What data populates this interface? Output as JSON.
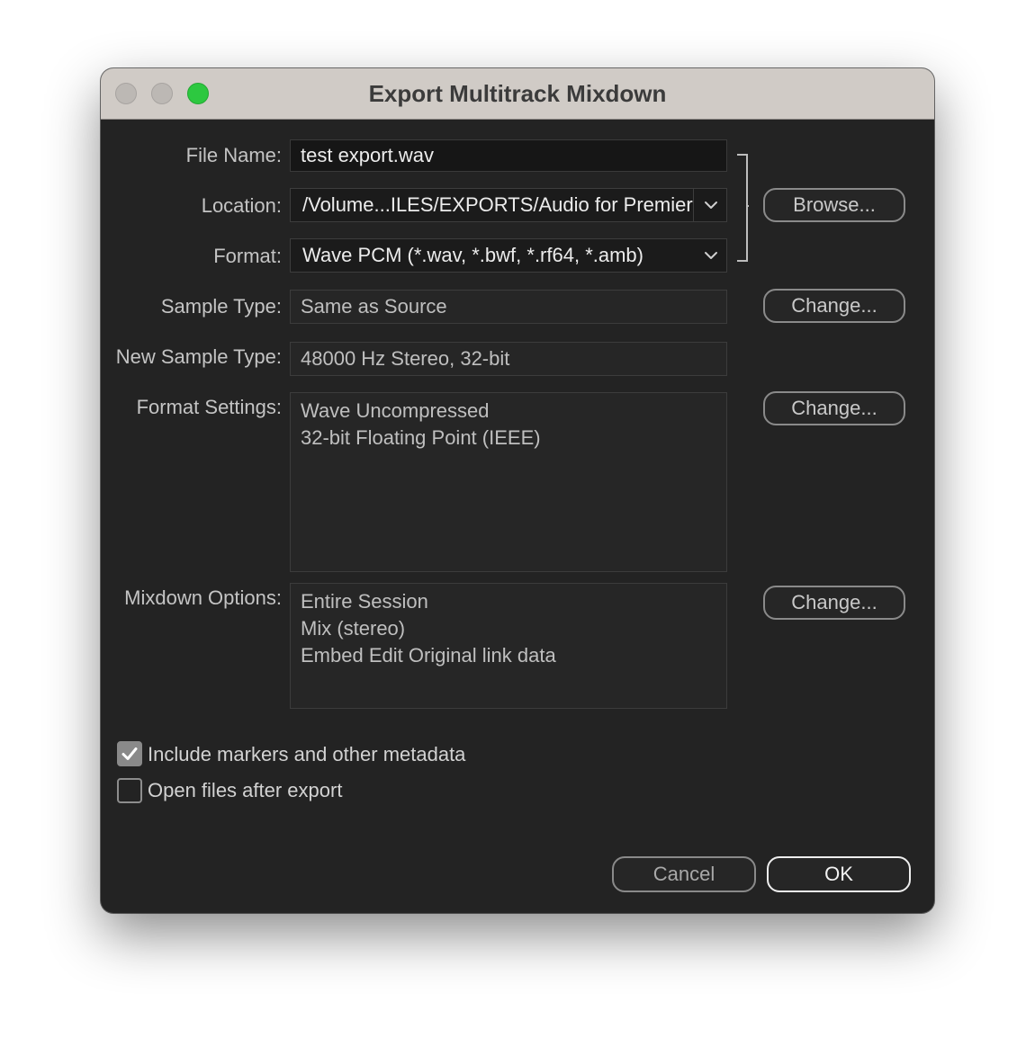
{
  "window": {
    "title": "Export Multitrack Mixdown"
  },
  "form": {
    "file_name_label": "File Name:",
    "file_name_value": "test export.wav",
    "location_label": "Location:",
    "location_value": "/Volume...ILES/EXPORTS/Audio for Premiere",
    "format_label": "Format:",
    "format_value": "Wave PCM (*.wav, *.bwf, *.rf64, *.amb)",
    "sample_type_label": "Sample Type:",
    "sample_type_value": "Same as Source",
    "new_sample_type_label": "New Sample Type:",
    "new_sample_type_value": "48000 Hz Stereo, 32-bit",
    "format_settings_label": "Format Settings:",
    "format_settings_lines": [
      "Wave Uncompressed",
      "32-bit Floating Point (IEEE)"
    ],
    "mixdown_options_label": "Mixdown Options:",
    "mixdown_options_lines": [
      "Entire Session",
      "Mix (stereo)",
      "Embed Edit Original link data"
    ]
  },
  "buttons": {
    "browse": "Browse...",
    "change_sample_type": "Change...",
    "change_format_settings": "Change...",
    "change_mixdown_options": "Change...",
    "cancel": "Cancel",
    "ok": "OK"
  },
  "options": {
    "include_markers_label": "Include markers and other metadata",
    "include_markers_checked": true,
    "open_files_label": "Open files after export",
    "open_files_checked": false
  },
  "icons": {
    "location_dropdown": "chevron-down-icon",
    "format_dropdown": "chevron-down-icon",
    "include_markers_check": "checkmark-icon"
  },
  "colors": {
    "close_button": "#bcb8b4",
    "minimize_button": "#bcb8b4",
    "zoom_button": "#2dc840",
    "dialog_background": "#232323",
    "title_bar": "#d0cbc6"
  }
}
